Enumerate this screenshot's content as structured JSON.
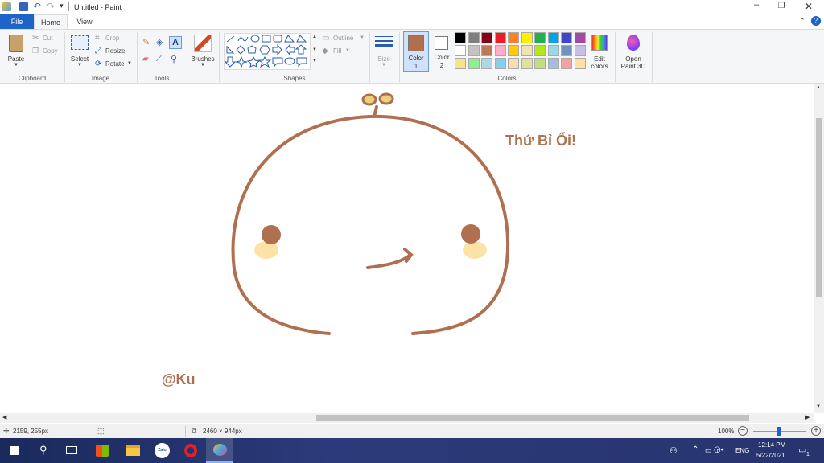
{
  "window": {
    "title": "Untitled - Paint"
  },
  "tabs": {
    "file": "File",
    "home": "Home",
    "view": "View"
  },
  "clipboard": {
    "paste": "Paste",
    "cut": "Cut",
    "copy": "Copy",
    "group": "Clipboard"
  },
  "image": {
    "select": "Select",
    "crop": "Crop",
    "resize": "Resize",
    "rotate": "Rotate",
    "group": "Image"
  },
  "tools": {
    "group": "Tools"
  },
  "brushes": {
    "label": "Brushes"
  },
  "shapes": {
    "group": "Shapes",
    "outline": "Outline",
    "fill": "Fill"
  },
  "size": {
    "label": "Size"
  },
  "colors": {
    "color1": "Color",
    "color1_num": "1",
    "color2": "Color",
    "color2_num": "2",
    "group": "Colors",
    "edit": "Edit",
    "edit2": "colors",
    "paint3d": "Open",
    "paint3d2": "Paint 3D",
    "color1_value": "#b07050",
    "color2_value": "#ffffff",
    "palette": [
      "#000000",
      "#7f7f7f",
      "#880015",
      "#ed1c24",
      "#ff7f27",
      "#fff200",
      "#22b14c",
      "#00a2e8",
      "#3f48cc",
      "#a349a4",
      "#ffffff",
      "#c3c3c3",
      "#b97a57",
      "#ffaec9",
      "#ffc90e",
      "#efe4b0",
      "#b5e61d",
      "#99d9ea",
      "#7092be",
      "#c8bfe7",
      "#f0e68c",
      "#90ee90",
      "#add8e6",
      "#87ceeb",
      "#f5deb3",
      "#e0e0a0",
      "#c0e080",
      "#a0c0e0",
      "#f4a0a0",
      "#ffe0a0"
    ]
  },
  "drawing": {
    "text1": "Thứ Bỉ Ổi!",
    "text2": "@Ku",
    "stroke": "#b07050",
    "cheek": "#fde2a7"
  },
  "status": {
    "cursor": "2159, 255px",
    "dimensions": "2460 × 944px",
    "zoom": "100%"
  },
  "taskbar": {
    "lang": "ENG",
    "time": "12:14 PM",
    "date": "5/22/2021",
    "notif": "1"
  }
}
